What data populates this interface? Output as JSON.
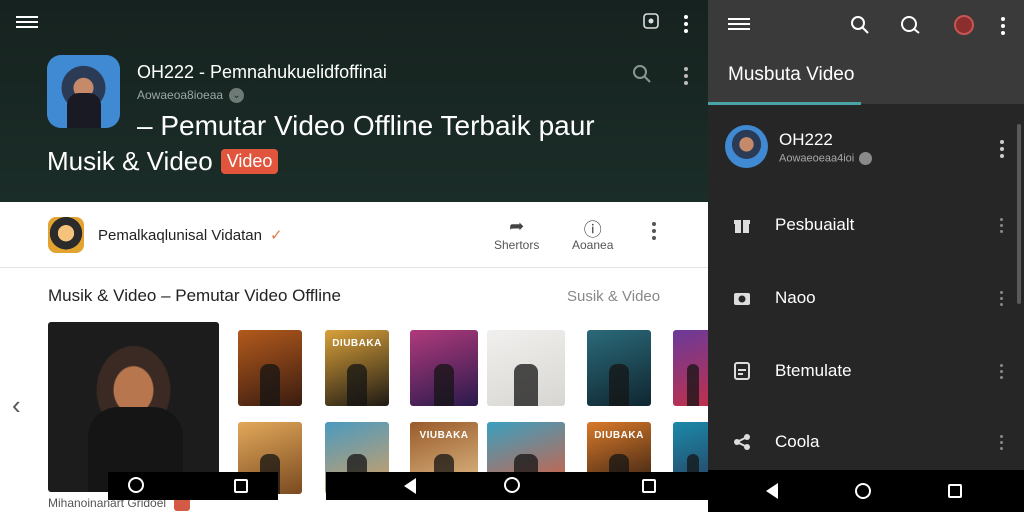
{
  "left_panel": {
    "hero": {
      "channel_title": "OH222 - Pemnahukuelidfoffinai",
      "channel_sub": "Aowaeoa8ioeaa",
      "headline_line1": "– Pemutar Video Offline Terbaik paur",
      "headline_line2": "Musik  & Video",
      "badge": "Video"
    },
    "channel_row": {
      "name": "Pemalkaqlunisal Vidatan",
      "check": "✓",
      "share_label": "Shertors",
      "info_label": "Aoanea"
    },
    "section": {
      "title": "Musik & Video – Pemutar Video Offline",
      "link": "Susik & Video",
      "prev": "‹"
    },
    "feature_caption": "Mihanoinanart Gridoel",
    "thumbnails": [
      {
        "title": "",
        "colors": [
          "#b35a1c",
          "#3a1c10"
        ]
      },
      {
        "title": "DIUBAKA",
        "colors": [
          "#d9a13a",
          "#1e1a14"
        ]
      },
      {
        "title": "",
        "colors": [
          "#b03a7c",
          "#2a1a4c"
        ]
      },
      {
        "title": "",
        "colors": [
          "#f2f0ee",
          "#d8d6d2"
        ]
      },
      {
        "title": "",
        "colors": [
          "#2b6a7a",
          "#0f2630"
        ]
      },
      {
        "title": "",
        "colors": [
          "#6a3a9a",
          "#c0304a"
        ]
      },
      {
        "title": "",
        "colors": [
          "#e2a85a",
          "#7a4a20"
        ]
      },
      {
        "title": "",
        "colors": [
          "#4a9ac0",
          "#d9a060"
        ]
      },
      {
        "title": "VIUBAKA",
        "colors": [
          "#9a5a2a",
          "#e0c08a"
        ]
      },
      {
        "title": "",
        "colors": [
          "#3aa0c0",
          "#e05a3a"
        ]
      },
      {
        "title": "DIUBAKA",
        "colors": [
          "#d97a2a",
          "#2a1a10"
        ]
      },
      {
        "title": "",
        "colors": [
          "#1a8aaa",
          "#2a3a5a"
        ]
      }
    ]
  },
  "right_panel": {
    "title": "Musbuta Video",
    "profile": {
      "name": "OH222",
      "sub": "Aowaeoeaa4ioi"
    },
    "items": [
      {
        "icon": "gift-icon",
        "label": "Pesbuaialt"
      },
      {
        "icon": "camera-icon",
        "label": "Naoo"
      },
      {
        "icon": "document-icon",
        "label": "Btemulate"
      },
      {
        "icon": "share-icon",
        "label": "Coola"
      }
    ]
  },
  "colors": {
    "hero_bg": "#16221f",
    "badge": "#e0553c",
    "accent_underline": "#4aa3a6",
    "drawer_bg": "#262626"
  }
}
